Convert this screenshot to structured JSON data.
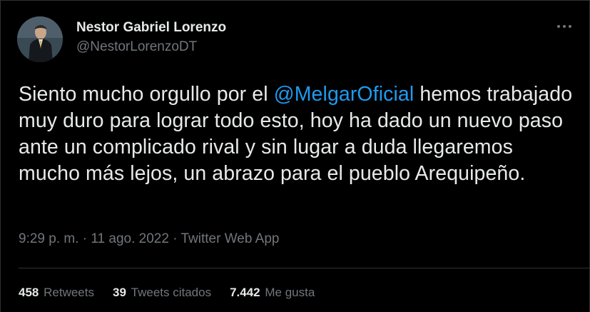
{
  "author": {
    "display_name": "Nestor Gabriel Lorenzo",
    "handle": "@NestorLorenzoDT"
  },
  "more_button": {
    "icon": "more-horizontal-icon"
  },
  "tweet": {
    "text_before": "Siento mucho orgullo por el ",
    "mention": "@MelgarOficial",
    "text_after": " hemos trabajado muy duro para lograr todo esto, hoy ha dado un nuevo paso ante un complicado rival y sin lugar a duda llegaremos mucho más lejos, un abrazo para el pueblo Arequipeño."
  },
  "meta": {
    "time": "9:29 p. m.",
    "separator1": " · ",
    "date": "11 ago. 2022",
    "separator2": " · ",
    "source": "Twitter Web App"
  },
  "stats": {
    "retweets_count": "458",
    "retweets_label": "Retweets",
    "quotes_count": "39",
    "quotes_label": "Tweets citados",
    "likes_count": "7.442",
    "likes_label": "Me gusta"
  },
  "colors": {
    "background": "#000000",
    "text": "#e7e9ea",
    "secondary": "#71767b",
    "link": "#1d9bf0",
    "border": "#2f3336"
  }
}
